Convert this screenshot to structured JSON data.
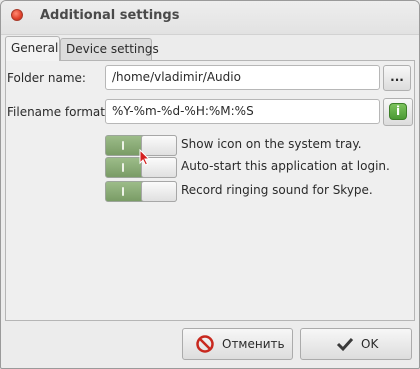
{
  "window": {
    "title": "Additional settings"
  },
  "tabs": [
    {
      "label": "General",
      "active": true
    },
    {
      "label": "Device settings",
      "active": false
    }
  ],
  "general": {
    "folder_label": "Folder name:",
    "folder_value": "/home/vladimir/Audio",
    "browse_label": "...",
    "filename_label": "Filename format:",
    "filename_value": "%Y-%m-%d-%H:%M:%S",
    "info_label": "i",
    "toggles": [
      {
        "label": "Show icon on the system tray.",
        "on": true
      },
      {
        "label": "Auto-start this application at login.",
        "on": true
      },
      {
        "label": "Record ringing sound for Skype.",
        "on": true
      }
    ]
  },
  "buttons": {
    "cancel_label": "Отменить",
    "ok_label": "OK"
  },
  "colors": {
    "toggle_on": "#7a9c66",
    "cancel_icon": "#c8281e",
    "info_icon": "#4b9a34"
  }
}
